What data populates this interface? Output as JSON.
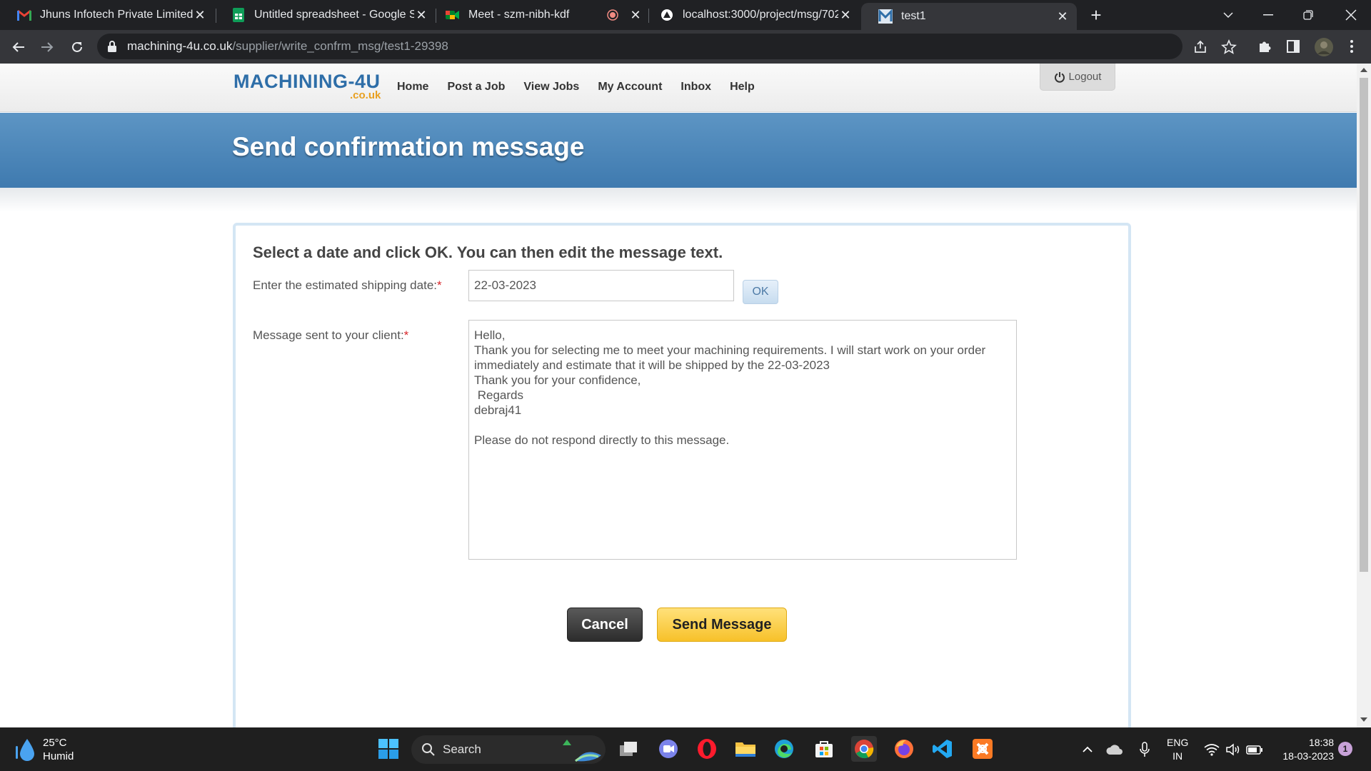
{
  "browser": {
    "tabs": [
      {
        "title": "Jhuns Infotech Private Limited M",
        "icon": "gmail-icon"
      },
      {
        "title": "Untitled spreadsheet - Google Sh",
        "icon": "sheets-icon"
      },
      {
        "title": "Meet - szm-nibh-kdf",
        "icon": "meet-icon"
      },
      {
        "title": "localhost:3000/project/msg/702/",
        "icon": "localhost-icon"
      },
      {
        "title": "test1",
        "icon": "machining-favicon"
      }
    ],
    "url_host": "machining-4u.co.uk",
    "url_path": "/supplier/write_confrm_msg/test1-29398"
  },
  "site": {
    "logo_main": "MACHINING-4U",
    "logo_sub": ".co.uk",
    "nav": [
      "Home",
      "Post a Job",
      "View Jobs",
      "My Account",
      "Inbox",
      "Help"
    ],
    "logout_label": "Logout",
    "page_title": "Send confirmation message"
  },
  "form": {
    "heading": "Select a date and click OK. You can then edit the message text.",
    "date_label": "Enter the estimated shipping date:",
    "required_mark": "*",
    "date_value": "22-03-2023",
    "ok_label": "OK",
    "message_label": "Message sent to your client:",
    "message_value": "Hello,\nThank you for selecting me to meet your machining requirements. I will start work on your order immediately and estimate that it will be shipped by the 22-03-2023\nThank you for your confidence,\n Regards\ndebraj41\n\nPlease do not respond directly to this message.",
    "cancel_label": "Cancel",
    "send_label": "Send Message"
  },
  "taskbar": {
    "temperature": "25°C",
    "weather": "Humid",
    "search_label": "Search",
    "lang_1": "ENG",
    "lang_2": "IN",
    "time": "18:38",
    "date": "18-03-2023",
    "notifications": "1"
  },
  "colors": {
    "banner": "#4a86bb",
    "send_button": "#f7c12a",
    "cancel_button": "#333333",
    "required": "#d8262a"
  }
}
